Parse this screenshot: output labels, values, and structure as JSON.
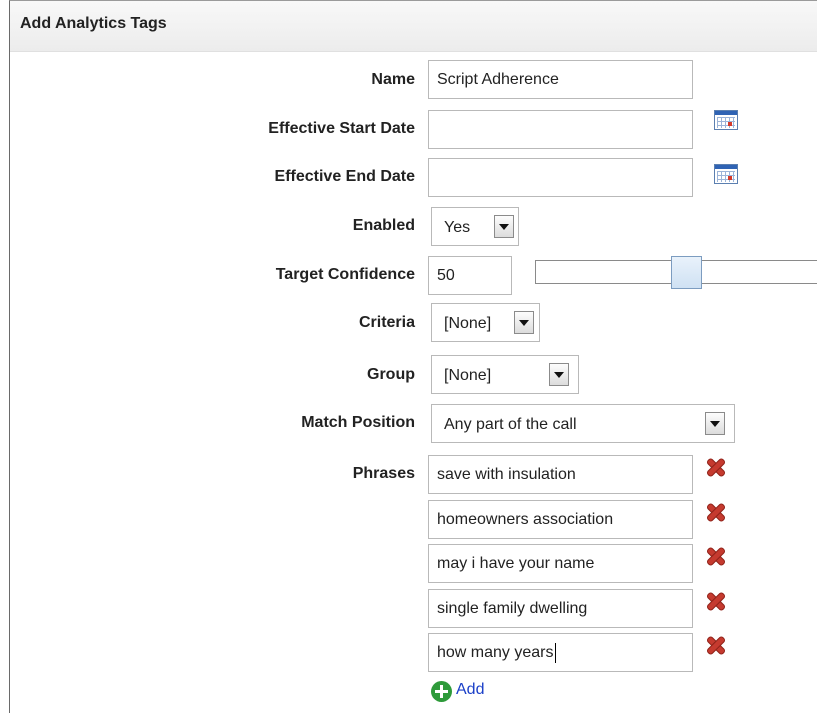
{
  "panel": {
    "title": "Add Analytics Tags"
  },
  "fields": {
    "name": {
      "label": "Name",
      "value": "Script Adherence"
    },
    "start_date": {
      "label": "Effective Start Date",
      "value": ""
    },
    "end_date": {
      "label": "Effective End Date",
      "value": ""
    },
    "enabled": {
      "label": "Enabled",
      "value": "Yes"
    },
    "target_confidence": {
      "label": "Target Confidence",
      "value": "50",
      "slider_level": 0.5
    },
    "criteria": {
      "label": "Criteria",
      "value": "[None]"
    },
    "group": {
      "label": "Group",
      "value": "[None]"
    },
    "match_position": {
      "label": "Match Position",
      "value": "Any part of the call"
    },
    "phrases": {
      "label": "Phrases",
      "items": [
        "save with insulation",
        "homeowners association",
        "may i have your name",
        "single family dwelling",
        "how many years"
      ]
    }
  },
  "add_link": "Add",
  "icons": {
    "calendar": "calendar-icon",
    "delete": "delete-x-icon",
    "add": "add-plus-icon"
  },
  "colors": {
    "link": "#1a3fc8",
    "delete": "#c53a2f",
    "add": "#2e9a3a"
  }
}
